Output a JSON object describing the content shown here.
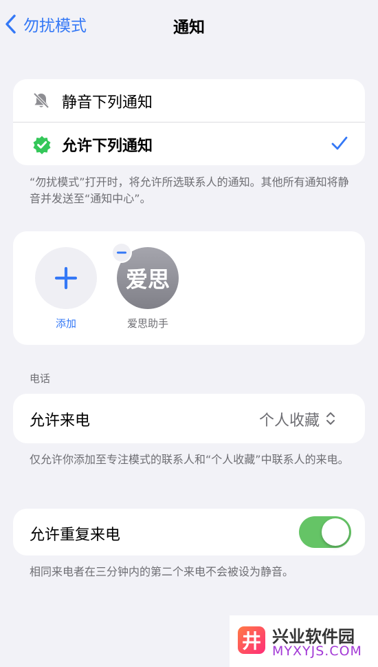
{
  "nav": {
    "back_label": "勿扰模式",
    "title": "通知"
  },
  "notify_options": {
    "silence_label": "静音下列通知",
    "allow_label": "允许下列通知",
    "selected": "allow"
  },
  "notify_footnote": "“勿扰模式”打开时，将允许所选联系人的通知。其他所有通知将静音并发送至“通知中心”。",
  "contacts": {
    "add_label": "添加",
    "people": [
      {
        "avatar_text": "爱思",
        "name": "爱思助手"
      }
    ]
  },
  "phone": {
    "section_header": "电话",
    "allow_calls_label": "允许来电",
    "allow_calls_value": "个人收藏",
    "footnote": "仅允许你添加至专注模式的联系人和“个人收藏”中联系人的来电。"
  },
  "repeat": {
    "label": "允许重复来电",
    "enabled": true,
    "footnote": "相同来电者在三分钟内的第二个来电不会被设为静音。"
  },
  "watermark": {
    "title": "兴业软件园",
    "url": "MYXYJS.COM",
    "logo_char": "井"
  },
  "colors": {
    "accent": "#3478f6",
    "toggle_on": "#65c466",
    "badge_green": "#34c759"
  }
}
